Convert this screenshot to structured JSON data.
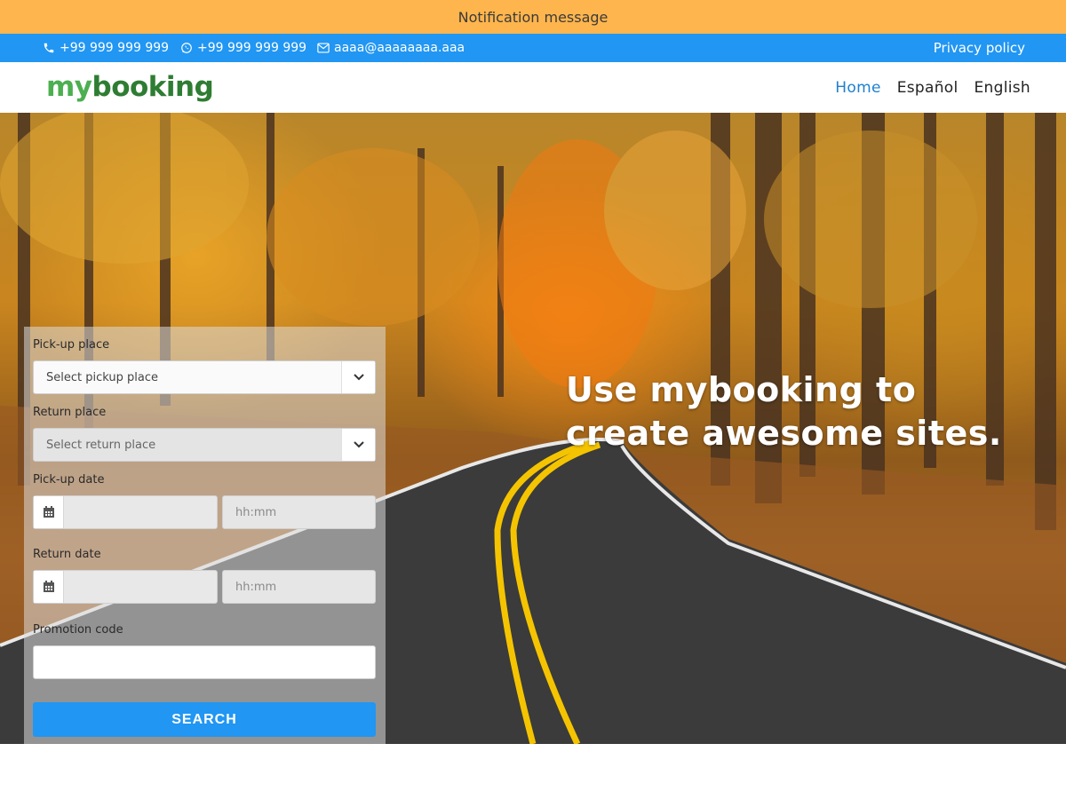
{
  "notification": {
    "text": "Notification message"
  },
  "topbar": {
    "phone": "+99 999 999 999",
    "whatsapp": "+99 999 999 999",
    "email": "aaaa@aaaaaaaa.aaa",
    "privacy": "Privacy policy",
    "color": "#2196f3"
  },
  "navbar": {
    "logo_part1": "my",
    "logo_part2": "booking",
    "links": [
      {
        "label": "Home",
        "active": true
      },
      {
        "label": "Español",
        "active": false
      },
      {
        "label": "English",
        "active": false
      }
    ]
  },
  "hero": {
    "tagline_line1": "Use mybooking to",
    "tagline_line2": "create awesome sites."
  },
  "form": {
    "pickup_place_label": "Pick-up place",
    "pickup_place_value": "Select pickup place",
    "return_place_label": "Return place",
    "return_place_value": "Select return place",
    "pickup_date_label": "Pick-up date",
    "pickup_time_placeholder": "hh:mm",
    "return_date_label": "Return date",
    "return_time_placeholder": "hh:mm",
    "promo_label": "Promotion code",
    "promo_value": "",
    "search_label": "SEARCH",
    "accent": "#2196f3"
  },
  "colors": {
    "notification_bg": "#ffb54d",
    "nav_active": "#1e7fd0"
  }
}
